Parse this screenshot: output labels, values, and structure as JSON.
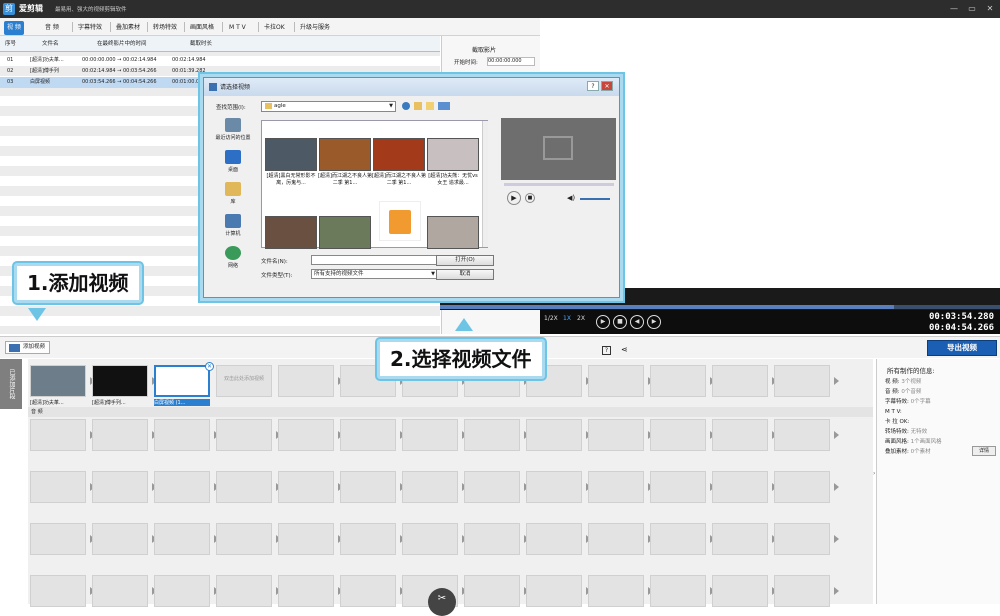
{
  "window": {
    "app_name": "爱剪辑",
    "subtitle": "最易用、强大的视频剪辑软件",
    "logo": "剪",
    "min": "—",
    "max": "▭",
    "close": "✕"
  },
  "menu": [
    "视 频",
    "音 频",
    "字幕特效",
    "叠加素材",
    "转场特效",
    "画面风格",
    "M T V",
    "卡拉OK",
    "升级与服务"
  ],
  "list": {
    "headers": [
      "序号",
      "文件名",
      "在最终影片中的时间",
      "截取时长"
    ],
    "rows": [
      [
        "01",
        "[超清]功夫革...",
        "00:00:00.000 → 00:02:14.984",
        "00:02:14.984"
      ],
      [
        "02",
        "[超清]傅手列",
        "00:02:14.984 → 00:03:54.266",
        "00:01:39.282"
      ],
      [
        "03",
        "白屏视频",
        "00:03:54.266 → 00:04:54.266",
        "00:01:00.000"
      ]
    ]
  },
  "cut_panel": {
    "title": "截取影片",
    "start_label": "开始时间:",
    "start_value": "00:00:00.000"
  },
  "dialog": {
    "title": "请选择视频",
    "lookin_label": "查找范围(I):",
    "folder": "agle",
    "places": [
      "最近访问的位置",
      "桌面",
      "库",
      "计算机",
      "网络"
    ],
    "files": [
      "[超清]黑白无常形影不离，厉鬼与...",
      "[超清]而江湖之不良人第二季 第1...",
      "[超清]而江湖之不良人第二季 第1...",
      "[超清]功夫熊：无忧vs女王 追求最..."
    ],
    "filename_label": "文件名(N):",
    "filename_value": "",
    "filetype_label": "文件类型(T):",
    "filetype_value": "所有支持的视频文件",
    "open_btn": "打开(O)",
    "cancel_btn": "取消"
  },
  "player": {
    "speeds": [
      "1/2X",
      "1X",
      "2X"
    ],
    "time_current": "00:03:54.280",
    "time_total": "00:04:54.266"
  },
  "toolbar": {
    "add_video": "添加视频",
    "export": "导出视频"
  },
  "timeline": {
    "side_tab": "已添加片段",
    "audio_label": "音 频",
    "clips": [
      "[超清]功夫革...",
      "[超清]傅手列...",
      "白屏视频 (1..."
    ],
    "placeholder": "双击此处添加视频"
  },
  "callouts": {
    "step1": "1.添加视频",
    "step2": "2.选择视频文件"
  },
  "info": {
    "title": "所有制作的信息:",
    "rows": [
      [
        "视  频:",
        "3个视频"
      ],
      [
        "音  频:",
        "0个音频"
      ],
      [
        "字幕特效:",
        "0个字幕"
      ],
      [
        "M  T  V:",
        ""
      ],
      [
        "卡 拉 OK:",
        ""
      ],
      [
        "转场特效:",
        "无特效"
      ],
      [
        "画面风格:",
        "1个画面风格"
      ],
      [
        "叠加素材:",
        "0个素材"
      ]
    ],
    "detail_btn": "详情"
  }
}
